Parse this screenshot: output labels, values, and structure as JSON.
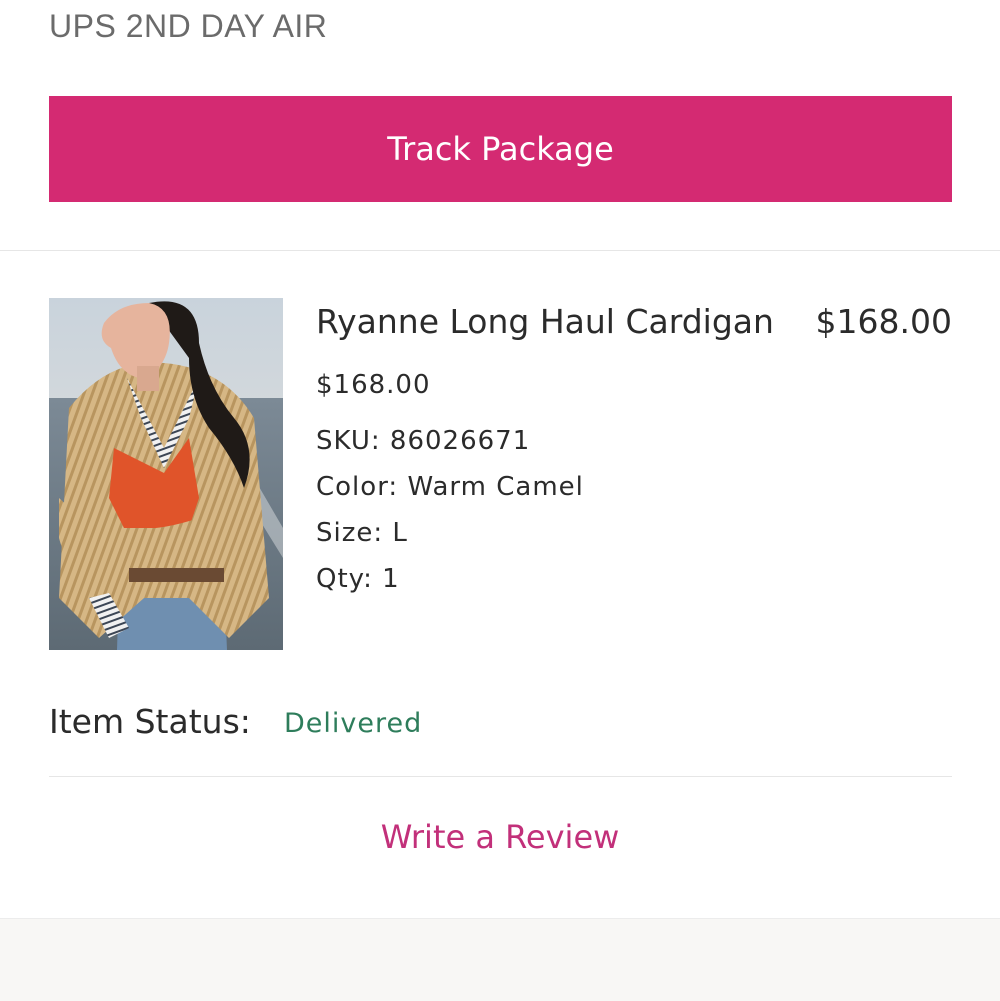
{
  "shipment": {
    "method": "UPS 2ND DAY AIR",
    "track_label": "Track Package"
  },
  "item": {
    "name": "Ryanne Long Haul Cardigan",
    "price_total": "$168.00",
    "unit_price": "$168.00",
    "sku": "SKU: 86026671",
    "color": "Color: Warm Camel",
    "size": "Size: L",
    "qty": "Qty: 1",
    "status_label": "Item Status:",
    "status_value": "Delivered"
  },
  "review": {
    "link_label": "Write a Review"
  },
  "colors": {
    "accent": "#d42a72",
    "link": "#c2307a",
    "status_delivered": "#2e7d5b"
  }
}
